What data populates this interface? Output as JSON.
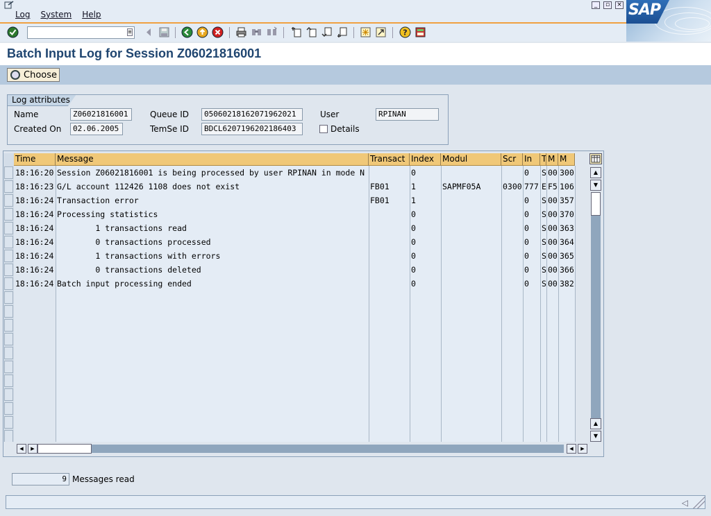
{
  "menu": {
    "items": [
      "Log",
      "System",
      "Help"
    ]
  },
  "window": {
    "minimize": "_",
    "restore": "▫",
    "close": "×"
  },
  "logo": {
    "text": "SAP"
  },
  "toolbar": {
    "command_value": "",
    "icons": [
      "enter-icon",
      "back-icon",
      "save-icon",
      "exit-icon",
      "up-icon",
      "cancel-icon",
      "print-icon",
      "find-icon",
      "find-next-icon",
      "first-page-icon",
      "prev-page-icon",
      "next-page-icon",
      "last-page-icon",
      "create-session-icon",
      "shortcut-icon",
      "help-icon",
      "customize-layout-icon"
    ]
  },
  "title": "Batch Input Log for Session Z06021816001",
  "app_toolbar": {
    "choose_label": "Choose"
  },
  "log_attributes": {
    "tab_label": "Log attributes",
    "name_label": "Name",
    "name_value": "Z06021816001",
    "created_label": "Created On",
    "created_value": "02.06.2005",
    "queue_label": "Queue ID",
    "queue_value": "05060218162071962021",
    "temse_label": "TemSe ID",
    "temse_value": "BDCL6207196202186403",
    "user_label": "User",
    "user_value": "RPINAN",
    "details_label": "Details",
    "details_checked": false
  },
  "table": {
    "columns": [
      "Time",
      "Message",
      "Transact",
      "Index",
      "Modul",
      "Scr",
      "In",
      "T",
      "M",
      "M"
    ],
    "rows": [
      [
        "18:16:20",
        "Session Z06021816001 is being processed by user RPINAN in mode N",
        "",
        "0",
        "",
        "",
        "0",
        "S",
        "00",
        "300"
      ],
      [
        "18:16:23",
        "G/L account 112426 1108 does not exist",
        "FB01",
        "1",
        "SAPMF05A",
        "0300",
        "777",
        "E",
        "F5",
        "106"
      ],
      [
        "18:16:24",
        "Transaction error",
        "FB01",
        "1",
        "",
        "",
        "0",
        "S",
        "00",
        "357"
      ],
      [
        "18:16:24",
        "Processing statistics",
        "",
        "0",
        "",
        "",
        "0",
        "S",
        "00",
        "370"
      ],
      [
        "18:16:24",
        "        1 transactions read",
        "",
        "0",
        "",
        "",
        "0",
        "S",
        "00",
        "363"
      ],
      [
        "18:16:24",
        "        0 transactions processed",
        "",
        "0",
        "",
        "",
        "0",
        "S",
        "00",
        "364"
      ],
      [
        "18:16:24",
        "        1 transactions with errors",
        "",
        "0",
        "",
        "",
        "0",
        "S",
        "00",
        "365"
      ],
      [
        "18:16:24",
        "        0 transactions deleted",
        "",
        "0",
        "",
        "",
        "0",
        "S",
        "00",
        "366"
      ],
      [
        "18:16:24",
        "Batch input processing ended",
        "",
        "0",
        "",
        "",
        "0",
        "S",
        "00",
        "382"
      ]
    ]
  },
  "footer": {
    "count": "9",
    "label": "Messages read"
  },
  "colors": {
    "header": "#f0c878",
    "title": "#1f4570",
    "app_toolbar": "#b5c9de",
    "accent": "#f0a040"
  }
}
